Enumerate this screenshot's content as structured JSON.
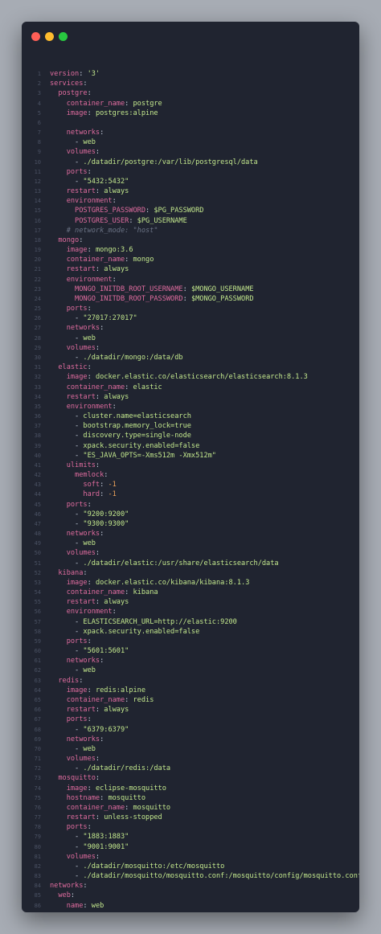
{
  "window": {
    "controls": [
      {
        "name": "close-button",
        "color": "#ff5f57"
      },
      {
        "name": "minimize-button",
        "color": "#febc2e"
      },
      {
        "name": "zoom-button",
        "color": "#28c840"
      }
    ]
  },
  "code": {
    "language": "yaml",
    "lines": [
      [
        {
          "t": "version",
          "c": "k"
        },
        {
          "t": ": ",
          "c": "p"
        },
        {
          "t": "'3'",
          "c": "v"
        }
      ],
      [
        {
          "t": "services",
          "c": "k"
        },
        {
          "t": ":",
          "c": "p"
        }
      ],
      [
        {
          "t": "  postgre",
          "c": "k"
        },
        {
          "t": ":",
          "c": "p"
        }
      ],
      [
        {
          "t": "    container_name",
          "c": "k"
        },
        {
          "t": ": ",
          "c": "p"
        },
        {
          "t": "postgre",
          "c": "v"
        }
      ],
      [
        {
          "t": "    image",
          "c": "k"
        },
        {
          "t": ": ",
          "c": "p"
        },
        {
          "t": "postgres:alpine",
          "c": "v"
        }
      ],
      [],
      [
        {
          "t": "    networks",
          "c": "k"
        },
        {
          "t": ":",
          "c": "p"
        }
      ],
      [
        {
          "t": "      - ",
          "c": "p"
        },
        {
          "t": "web",
          "c": "v"
        }
      ],
      [
        {
          "t": "    volumes",
          "c": "k"
        },
        {
          "t": ":",
          "c": "p"
        }
      ],
      [
        {
          "t": "      - ",
          "c": "p"
        },
        {
          "t": "./datadir/postgre:/var/lib/postgresql/data",
          "c": "v"
        }
      ],
      [
        {
          "t": "    ports",
          "c": "k"
        },
        {
          "t": ":",
          "c": "p"
        }
      ],
      [
        {
          "t": "      - ",
          "c": "p"
        },
        {
          "t": "\"5432:5432\"",
          "c": "v"
        }
      ],
      [
        {
          "t": "    restart",
          "c": "k"
        },
        {
          "t": ": ",
          "c": "p"
        },
        {
          "t": "always",
          "c": "v"
        }
      ],
      [
        {
          "t": "    environment",
          "c": "k"
        },
        {
          "t": ":",
          "c": "p"
        }
      ],
      [
        {
          "t": "      POSTGRES_PASSWORD",
          "c": "k"
        },
        {
          "t": ": ",
          "c": "p"
        },
        {
          "t": "$PG_PASSWORD",
          "c": "v"
        }
      ],
      [
        {
          "t": "      POSTGRES_USER",
          "c": "k"
        },
        {
          "t": ": ",
          "c": "p"
        },
        {
          "t": "$PG_USERNAME",
          "c": "v"
        }
      ],
      [
        {
          "t": "    # network_mode: \"host\"",
          "c": "c"
        }
      ],
      [
        {
          "t": "  mongo",
          "c": "k"
        },
        {
          "t": ":",
          "c": "p"
        }
      ],
      [
        {
          "t": "    image",
          "c": "k"
        },
        {
          "t": ": ",
          "c": "p"
        },
        {
          "t": "mongo:3.6",
          "c": "v"
        }
      ],
      [
        {
          "t": "    container_name",
          "c": "k"
        },
        {
          "t": ": ",
          "c": "p"
        },
        {
          "t": "mongo",
          "c": "v"
        }
      ],
      [
        {
          "t": "    restart",
          "c": "k"
        },
        {
          "t": ": ",
          "c": "p"
        },
        {
          "t": "always",
          "c": "v"
        }
      ],
      [
        {
          "t": "    environment",
          "c": "k"
        },
        {
          "t": ":",
          "c": "p"
        }
      ],
      [
        {
          "t": "      MONGO_INITDB_ROOT_USERNAME",
          "c": "k"
        },
        {
          "t": ": ",
          "c": "p"
        },
        {
          "t": "$MONGO_USERNAME",
          "c": "v"
        }
      ],
      [
        {
          "t": "      MONGO_INITDB_ROOT_PASSWORD",
          "c": "k"
        },
        {
          "t": ": ",
          "c": "p"
        },
        {
          "t": "$MONGO_PASSWORD",
          "c": "v"
        }
      ],
      [
        {
          "t": "    ports",
          "c": "k"
        },
        {
          "t": ":",
          "c": "p"
        }
      ],
      [
        {
          "t": "      - ",
          "c": "p"
        },
        {
          "t": "\"27017:27017\"",
          "c": "v"
        }
      ],
      [
        {
          "t": "    networks",
          "c": "k"
        },
        {
          "t": ":",
          "c": "p"
        }
      ],
      [
        {
          "t": "      - ",
          "c": "p"
        },
        {
          "t": "web",
          "c": "v"
        }
      ],
      [
        {
          "t": "    volumes",
          "c": "k"
        },
        {
          "t": ":",
          "c": "p"
        }
      ],
      [
        {
          "t": "      - ",
          "c": "p"
        },
        {
          "t": "./datadir/mongo:/data/db",
          "c": "v"
        }
      ],
      [
        {
          "t": "  elastic",
          "c": "k"
        },
        {
          "t": ":",
          "c": "p"
        }
      ],
      [
        {
          "t": "    image",
          "c": "k"
        },
        {
          "t": ": ",
          "c": "p"
        },
        {
          "t": "docker.elastic.co/elasticsearch/elasticsearch:8.1.3",
          "c": "v"
        }
      ],
      [
        {
          "t": "    container_name",
          "c": "k"
        },
        {
          "t": ": ",
          "c": "p"
        },
        {
          "t": "elastic",
          "c": "v"
        }
      ],
      [
        {
          "t": "    restart",
          "c": "k"
        },
        {
          "t": ": ",
          "c": "p"
        },
        {
          "t": "always",
          "c": "v"
        }
      ],
      [
        {
          "t": "    environment",
          "c": "k"
        },
        {
          "t": ":",
          "c": "p"
        }
      ],
      [
        {
          "t": "      - ",
          "c": "p"
        },
        {
          "t": "cluster.name=elasticsearch",
          "c": "v"
        }
      ],
      [
        {
          "t": "      - ",
          "c": "p"
        },
        {
          "t": "bootstrap.memory_lock=true",
          "c": "v"
        }
      ],
      [
        {
          "t": "      - ",
          "c": "p"
        },
        {
          "t": "discovery.type=single-node",
          "c": "v"
        }
      ],
      [
        {
          "t": "      - ",
          "c": "p"
        },
        {
          "t": "xpack.security.enabled=false",
          "c": "v"
        }
      ],
      [
        {
          "t": "      - ",
          "c": "p"
        },
        {
          "t": "\"ES_JAVA_OPTS=-Xms512m -Xmx512m\"",
          "c": "v"
        }
      ],
      [
        {
          "t": "    ulimits",
          "c": "k"
        },
        {
          "t": ":",
          "c": "p"
        }
      ],
      [
        {
          "t": "      memlock",
          "c": "k"
        },
        {
          "t": ":",
          "c": "p"
        }
      ],
      [
        {
          "t": "        soft",
          "c": "k"
        },
        {
          "t": ": ",
          "c": "p"
        },
        {
          "t": "-1",
          "c": "d"
        }
      ],
      [
        {
          "t": "        hard",
          "c": "k"
        },
        {
          "t": ": ",
          "c": "p"
        },
        {
          "t": "-1",
          "c": "d"
        }
      ],
      [
        {
          "t": "    ports",
          "c": "k"
        },
        {
          "t": ":",
          "c": "p"
        }
      ],
      [
        {
          "t": "      - ",
          "c": "p"
        },
        {
          "t": "\"9200:9200\"",
          "c": "v"
        }
      ],
      [
        {
          "t": "      - ",
          "c": "p"
        },
        {
          "t": "\"9300:9300\"",
          "c": "v"
        }
      ],
      [
        {
          "t": "    networks",
          "c": "k"
        },
        {
          "t": ":",
          "c": "p"
        }
      ],
      [
        {
          "t": "      - ",
          "c": "p"
        },
        {
          "t": "web",
          "c": "v"
        }
      ],
      [
        {
          "t": "    volumes",
          "c": "k"
        },
        {
          "t": ":",
          "c": "p"
        }
      ],
      [
        {
          "t": "      - ",
          "c": "p"
        },
        {
          "t": "./datadir/elastic:/usr/share/elasticsearch/data",
          "c": "v"
        }
      ],
      [
        {
          "t": "  kibana",
          "c": "k"
        },
        {
          "t": ":",
          "c": "p"
        }
      ],
      [
        {
          "t": "    image",
          "c": "k"
        },
        {
          "t": ": ",
          "c": "p"
        },
        {
          "t": "docker.elastic.co/kibana/kibana:8.1.3",
          "c": "v"
        }
      ],
      [
        {
          "t": "    container_name",
          "c": "k"
        },
        {
          "t": ": ",
          "c": "p"
        },
        {
          "t": "kibana",
          "c": "v"
        }
      ],
      [
        {
          "t": "    restart",
          "c": "k"
        },
        {
          "t": ": ",
          "c": "p"
        },
        {
          "t": "always",
          "c": "v"
        }
      ],
      [
        {
          "t": "    environment",
          "c": "k"
        },
        {
          "t": ":",
          "c": "p"
        }
      ],
      [
        {
          "t": "      - ",
          "c": "p"
        },
        {
          "t": "ELASTICSEARCH_URL=http://elastic:9200",
          "c": "v"
        }
      ],
      [
        {
          "t": "      - ",
          "c": "p"
        },
        {
          "t": "xpack.security.enabled=false",
          "c": "v"
        }
      ],
      [
        {
          "t": "    ports",
          "c": "k"
        },
        {
          "t": ":",
          "c": "p"
        }
      ],
      [
        {
          "t": "      - ",
          "c": "p"
        },
        {
          "t": "\"5601:5601\"",
          "c": "v"
        }
      ],
      [
        {
          "t": "    networks",
          "c": "k"
        },
        {
          "t": ":",
          "c": "p"
        }
      ],
      [
        {
          "t": "      - ",
          "c": "p"
        },
        {
          "t": "web",
          "c": "v"
        }
      ],
      [
        {
          "t": "  redis",
          "c": "k"
        },
        {
          "t": ":",
          "c": "p"
        }
      ],
      [
        {
          "t": "    image",
          "c": "k"
        },
        {
          "t": ": ",
          "c": "p"
        },
        {
          "t": "redis:alpine",
          "c": "v"
        }
      ],
      [
        {
          "t": "    container_name",
          "c": "k"
        },
        {
          "t": ": ",
          "c": "p"
        },
        {
          "t": "redis",
          "c": "v"
        }
      ],
      [
        {
          "t": "    restart",
          "c": "k"
        },
        {
          "t": ": ",
          "c": "p"
        },
        {
          "t": "always",
          "c": "v"
        }
      ],
      [
        {
          "t": "    ports",
          "c": "k"
        },
        {
          "t": ":",
          "c": "p"
        }
      ],
      [
        {
          "t": "      - ",
          "c": "p"
        },
        {
          "t": "\"6379:6379\"",
          "c": "v"
        }
      ],
      [
        {
          "t": "    networks",
          "c": "k"
        },
        {
          "t": ":",
          "c": "p"
        }
      ],
      [
        {
          "t": "      - ",
          "c": "p"
        },
        {
          "t": "web",
          "c": "v"
        }
      ],
      [
        {
          "t": "    volumes",
          "c": "k"
        },
        {
          "t": ":",
          "c": "p"
        }
      ],
      [
        {
          "t": "      - ",
          "c": "p"
        },
        {
          "t": "./datadir/redis:/data",
          "c": "v"
        }
      ],
      [
        {
          "t": "  mosquitto",
          "c": "k"
        },
        {
          "t": ":",
          "c": "p"
        }
      ],
      [
        {
          "t": "    image",
          "c": "k"
        },
        {
          "t": ": ",
          "c": "p"
        },
        {
          "t": "eclipse-mosquitto",
          "c": "v"
        }
      ],
      [
        {
          "t": "    hostname",
          "c": "k"
        },
        {
          "t": ": ",
          "c": "p"
        },
        {
          "t": "mosquitto",
          "c": "v"
        }
      ],
      [
        {
          "t": "    container_name",
          "c": "k"
        },
        {
          "t": ": ",
          "c": "p"
        },
        {
          "t": "mosquitto",
          "c": "v"
        }
      ],
      [
        {
          "t": "    restart",
          "c": "k"
        },
        {
          "t": ": ",
          "c": "p"
        },
        {
          "t": "unless-stopped",
          "c": "v"
        }
      ],
      [
        {
          "t": "    ports",
          "c": "k"
        },
        {
          "t": ":",
          "c": "p"
        }
      ],
      [
        {
          "t": "      - ",
          "c": "p"
        },
        {
          "t": "\"1883:1883\"",
          "c": "v"
        }
      ],
      [
        {
          "t": "      - ",
          "c": "p"
        },
        {
          "t": "\"9001:9001\"",
          "c": "v"
        }
      ],
      [
        {
          "t": "    volumes",
          "c": "k"
        },
        {
          "t": ":",
          "c": "p"
        }
      ],
      [
        {
          "t": "      - ",
          "c": "p"
        },
        {
          "t": "./datadir/mosquitto:/etc/mosquitto",
          "c": "v"
        }
      ],
      [
        {
          "t": "      - ",
          "c": "p"
        },
        {
          "t": "./datadir/mosquitto/mosquitto.conf:/mosquitto/config/mosquitto.conf",
          "c": "v"
        }
      ],
      [
        {
          "t": "networks",
          "c": "k"
        },
        {
          "t": ":",
          "c": "p"
        }
      ],
      [
        {
          "t": "  web",
          "c": "k"
        },
        {
          "t": ":",
          "c": "p"
        }
      ],
      [
        {
          "t": "    name",
          "c": "k"
        },
        {
          "t": ": ",
          "c": "p"
        },
        {
          "t": "web",
          "c": "v"
        }
      ],
      []
    ]
  }
}
